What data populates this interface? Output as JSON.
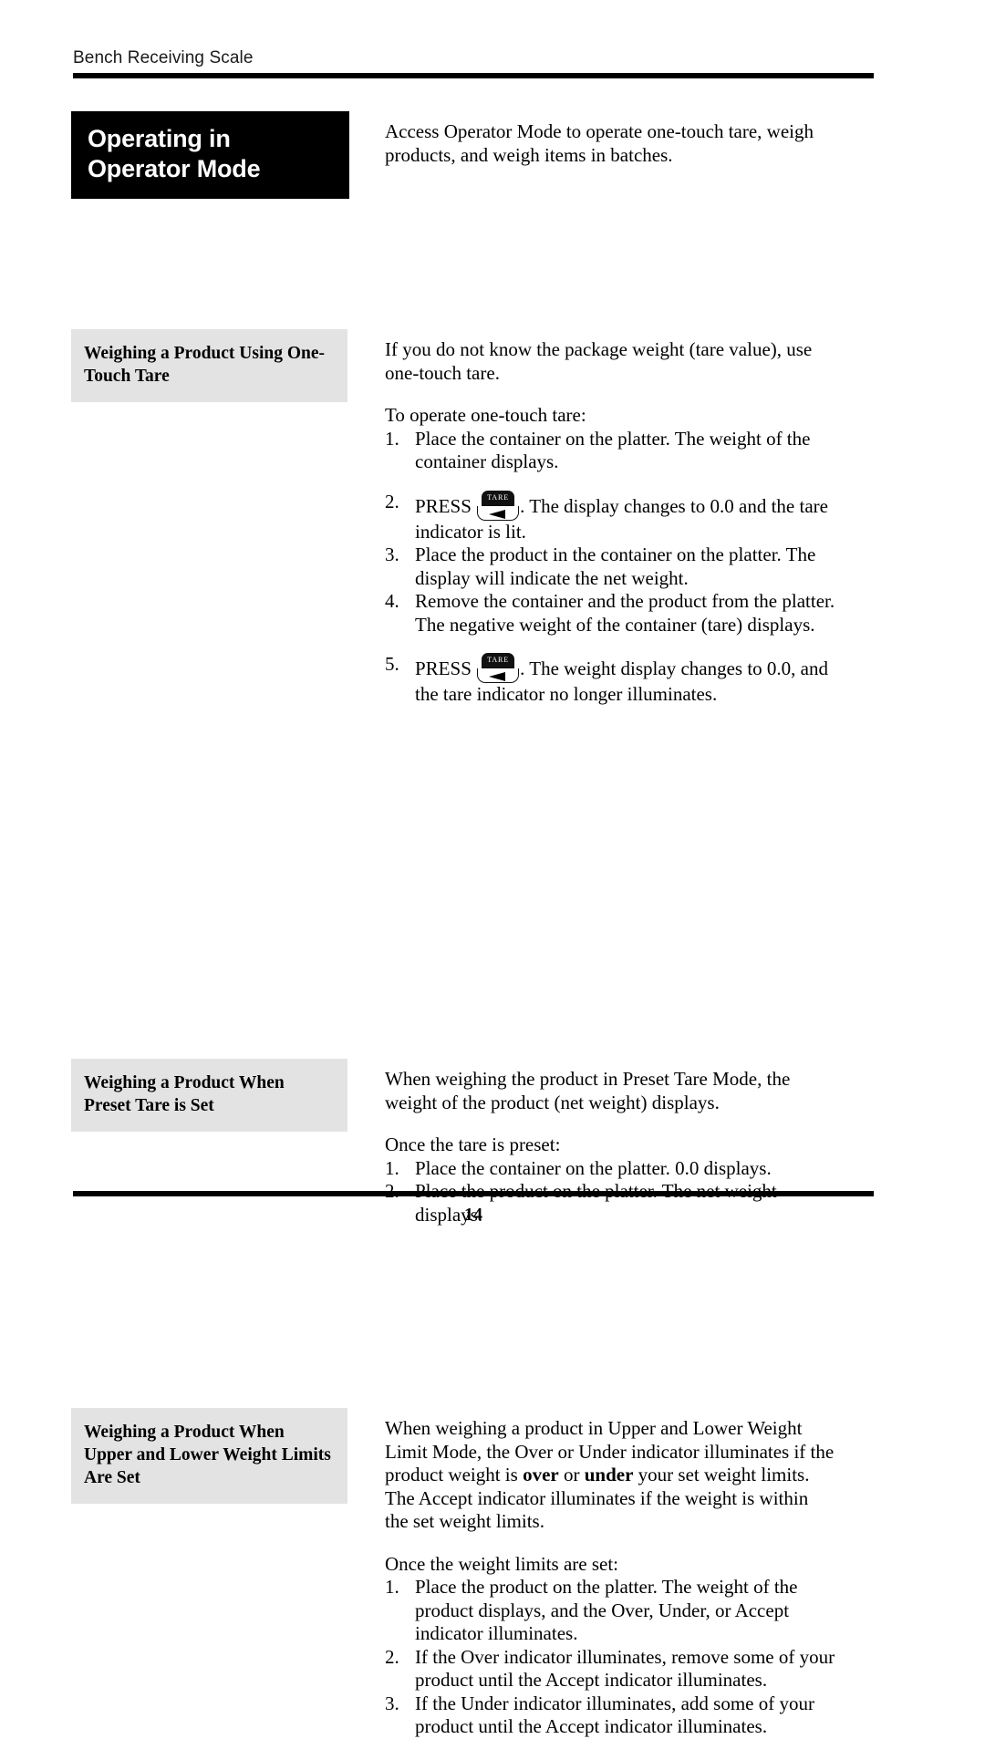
{
  "header": {
    "running_title": "Bench Receiving Scale"
  },
  "title_box": {
    "title": "Operating in Operator Mode"
  },
  "intro": {
    "paragraph": "Access Operator Mode to operate one-touch tare, weigh products, and weigh items in batches."
  },
  "sections": [
    {
      "heading": "Weighing a Product Using One-Touch Tare",
      "intro": "If you do not know the package weight (tare value), use one-touch tare.",
      "lead_in": "To operate one-touch tare:",
      "steps": [
        {
          "num": "1.",
          "before": "Place the container on the platter. The weight of the container displays.",
          "key": null,
          "after": ""
        },
        {
          "num": "2.",
          "before": "PRESS ",
          "key": "TARE",
          "after": ". The display changes to 0.0 and the tare indicator is lit."
        },
        {
          "num": "3.",
          "before": "Place the product in the container on the platter. The display will indicate the net weight.",
          "key": null,
          "after": ""
        },
        {
          "num": "4.",
          "before": "Remove the container and the product from the platter. The negative weight of the container (tare) displays.",
          "key": null,
          "after": ""
        },
        {
          "num": "5.",
          "before": "PRESS ",
          "key": "TARE",
          "after": ". The weight display changes to 0.0, and the tare indicator no longer illuminates."
        }
      ]
    },
    {
      "heading": "Weighing a Product When Preset Tare is Set",
      "intro": "When weighing the product in Preset Tare Mode, the weight of the product (net weight) displays.",
      "lead_in": "Once the tare is preset:",
      "steps": [
        {
          "num": "1.",
          "before": "Place the container on the platter. 0.0 displays.",
          "key": null,
          "after": ""
        },
        {
          "num": "2.",
          "before": "Place the product on the platter. The net weight displays.",
          "key": null,
          "after": ""
        }
      ]
    },
    {
      "heading": "Weighing a Product When Upper and Lower Weight Limits Are Set",
      "intro_rich": {
        "p1": "When weighing a product in Upper and Lower Weight Limit Mode, the Over or Under indicator illuminates if the product weight is ",
        "bold1": "over",
        "p2": " or ",
        "bold2": "under",
        "p3": " your set weight limits. The Accept indicator illuminates if the weight is within the set weight limits."
      },
      "lead_in": "Once the weight limits are set:",
      "steps": [
        {
          "num": "1.",
          "before": "Place the product on the platter. The weight of the product displays, and the Over, Under, or Accept indicator illuminates.",
          "key": null,
          "after": ""
        },
        {
          "num": "2.",
          "before": "If the Over indicator illuminates, remove some of your product until the Accept indicator illuminates.",
          "key": null,
          "after": ""
        },
        {
          "num": "3.",
          "before": "If the Under indicator illuminates, add some of your product until the Accept indicator illuminates.",
          "key": null,
          "after": ""
        }
      ]
    }
  ],
  "footer": {
    "page_number": "14"
  },
  "colors": {
    "title_box_bg": "#000000",
    "heading_box_bg": "#e3e3e3",
    "rule": "#000000",
    "text": "#000000"
  }
}
